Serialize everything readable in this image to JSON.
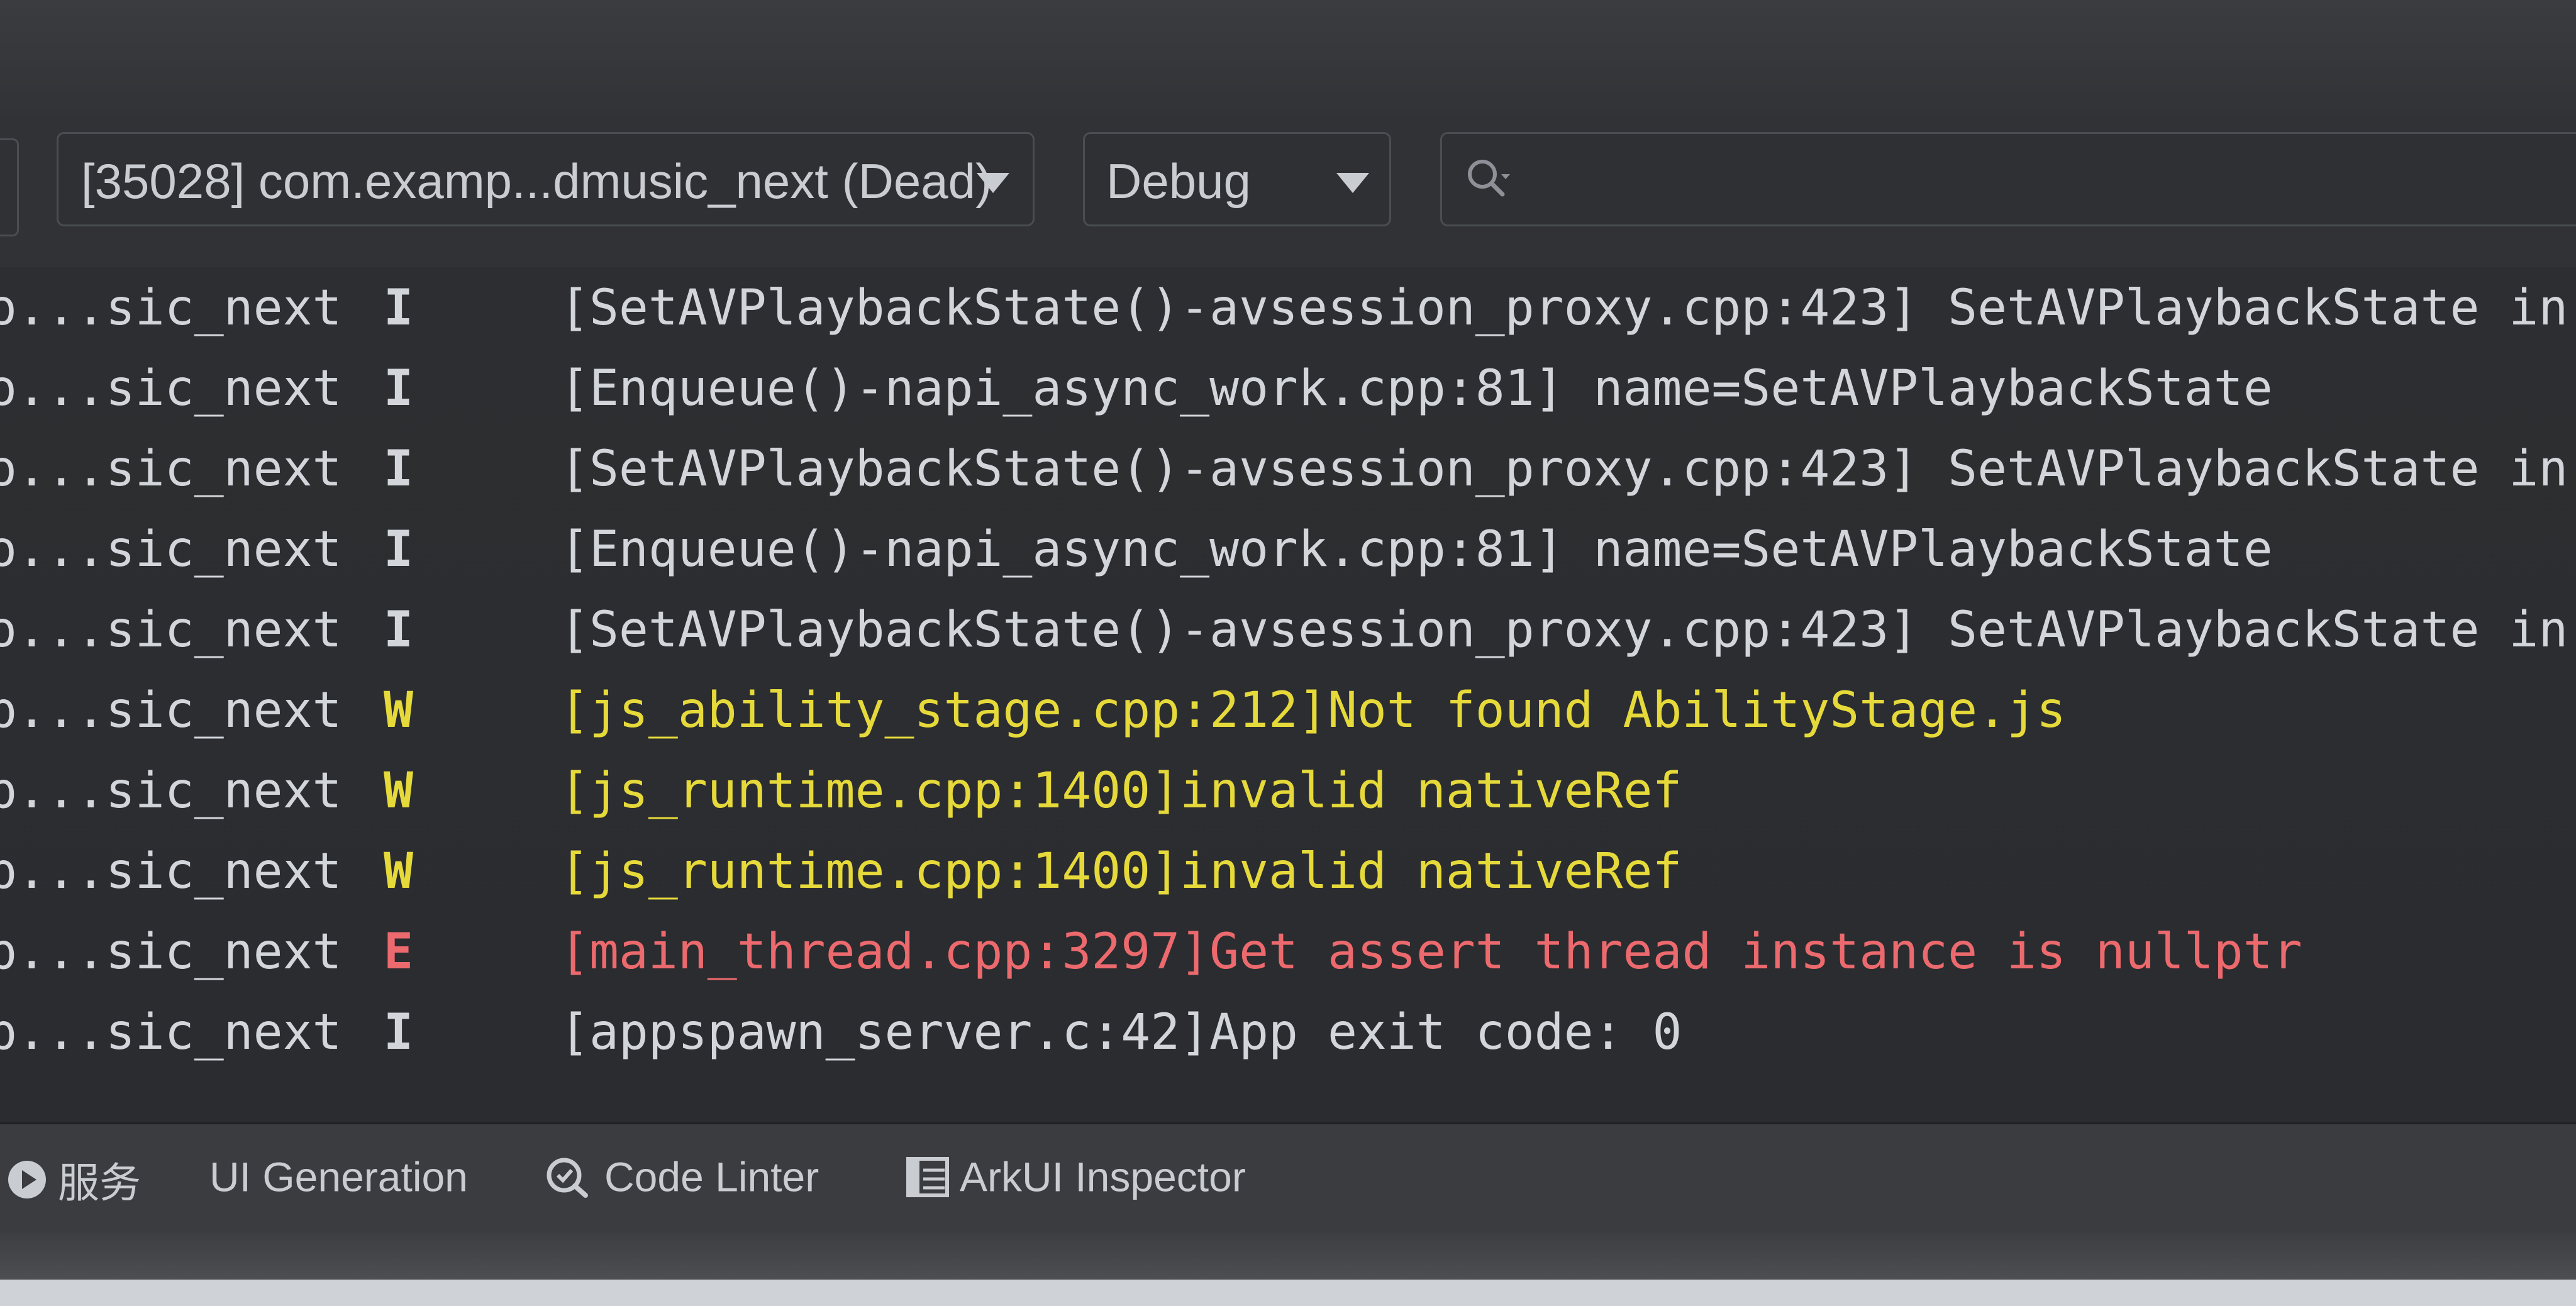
{
  "toolbar": {
    "process_label": "[35028] com.examp...dmusic_next (Dead)",
    "level_label": "Debug",
    "search_placeholder": "",
    "search_value": ""
  },
  "log": {
    "rows": [
      {
        "tag": "o...sic_next",
        "level": "I",
        "message": "[SetAVPlaybackState()-avsession_proxy.cpp:423] SetAVPlaybackState in"
      },
      {
        "tag": "o...sic_next",
        "level": "I",
        "message": "[Enqueue()-napi_async_work.cpp:81] name=SetAVPlaybackState"
      },
      {
        "tag": "o...sic_next",
        "level": "I",
        "message": "[SetAVPlaybackState()-avsession_proxy.cpp:423] SetAVPlaybackState in"
      },
      {
        "tag": "o...sic_next",
        "level": "I",
        "message": "[Enqueue()-napi_async_work.cpp:81] name=SetAVPlaybackState"
      },
      {
        "tag": "o...sic_next",
        "level": "I",
        "message": "[SetAVPlaybackState()-avsession_proxy.cpp:423] SetAVPlaybackState in"
      },
      {
        "tag": "p...sic_next",
        "level": "W",
        "message": "[js_ability_stage.cpp:212]Not found AbilityStage.js"
      },
      {
        "tag": "p...sic_next",
        "level": "W",
        "message": "[js_runtime.cpp:1400]invalid nativeRef"
      },
      {
        "tag": "p...sic_next",
        "level": "W",
        "message": "[js_runtime.cpp:1400]invalid nativeRef"
      },
      {
        "tag": "p...sic_next",
        "level": "E",
        "message": "[main_thread.cpp:3297]Get assert thread instance is nullptr"
      },
      {
        "tag": "p...sic_next",
        "level": "I",
        "message": "[appspawn_server.c:42]App exit code: 0"
      }
    ]
  },
  "bottom_bar": {
    "tools": [
      {
        "label": "服务",
        "icon": "services-play-icon"
      },
      {
        "label": "UI Generation",
        "icon": ""
      },
      {
        "label": "Code Linter",
        "icon": "code-linter-icon"
      },
      {
        "label": "ArkUI Inspector",
        "icon": "inspector-icon"
      }
    ]
  },
  "colors": {
    "info": "#d2d5da",
    "warn": "#e6d93a",
    "error": "#ec6a6e",
    "background": "#2b2d30"
  }
}
